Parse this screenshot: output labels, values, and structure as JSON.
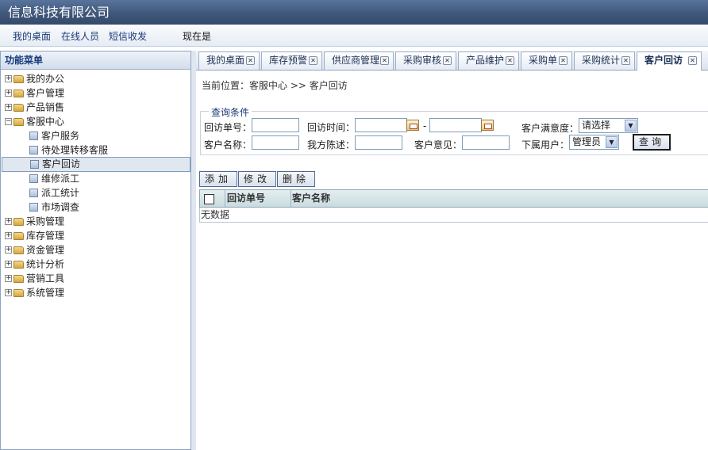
{
  "app": {
    "title": "信息科技有限公司"
  },
  "topnav": {
    "desktop": "我的桌面",
    "online": "在线人员",
    "sms": "短信收发",
    "now_label": "现在是"
  },
  "sidebar": {
    "header": "功能菜单",
    "items": [
      {
        "label": "我的办公"
      },
      {
        "label": "客户管理"
      },
      {
        "label": "产品销售"
      },
      {
        "label": "客服中心"
      },
      {
        "label": "客户服务"
      },
      {
        "label": "待处理转移客服"
      },
      {
        "label": "客户回访"
      },
      {
        "label": "维修派工"
      },
      {
        "label": "派工统计"
      },
      {
        "label": "市场调查"
      },
      {
        "label": "采购管理"
      },
      {
        "label": "库存管理"
      },
      {
        "label": "资金管理"
      },
      {
        "label": "统计分析"
      },
      {
        "label": "营销工具"
      },
      {
        "label": "系统管理"
      }
    ]
  },
  "tabs": [
    {
      "label": "我的桌面"
    },
    {
      "label": "库存预警"
    },
    {
      "label": "供应商管理"
    },
    {
      "label": "采购审核"
    },
    {
      "label": "产品维护"
    },
    {
      "label": "采购单"
    },
    {
      "label": "采购统计"
    },
    {
      "label": "客户回访"
    }
  ],
  "breadcrumb": "当前位置：客服中心 >> 客户回访",
  "query": {
    "legend": "查询条件",
    "visit_no_label": "回访单号：",
    "visit_time_label": "回访时间：",
    "dash": "-",
    "satisfaction_label": "客户满意度：",
    "satisfaction_value": "请选择",
    "customer_name_label": "客户名称：",
    "our_statement_label": "我方陈述：",
    "customer_opinion_label": "客户意见：",
    "sub_user_label": "下属用户：",
    "sub_user_value": "管理员",
    "query_button": "查询"
  },
  "actions": {
    "add": "添加",
    "edit": "修改",
    "delete": "删除"
  },
  "grid": {
    "columns": [
      "回访单号",
      "客户名称"
    ],
    "empty_text": "无数据"
  }
}
